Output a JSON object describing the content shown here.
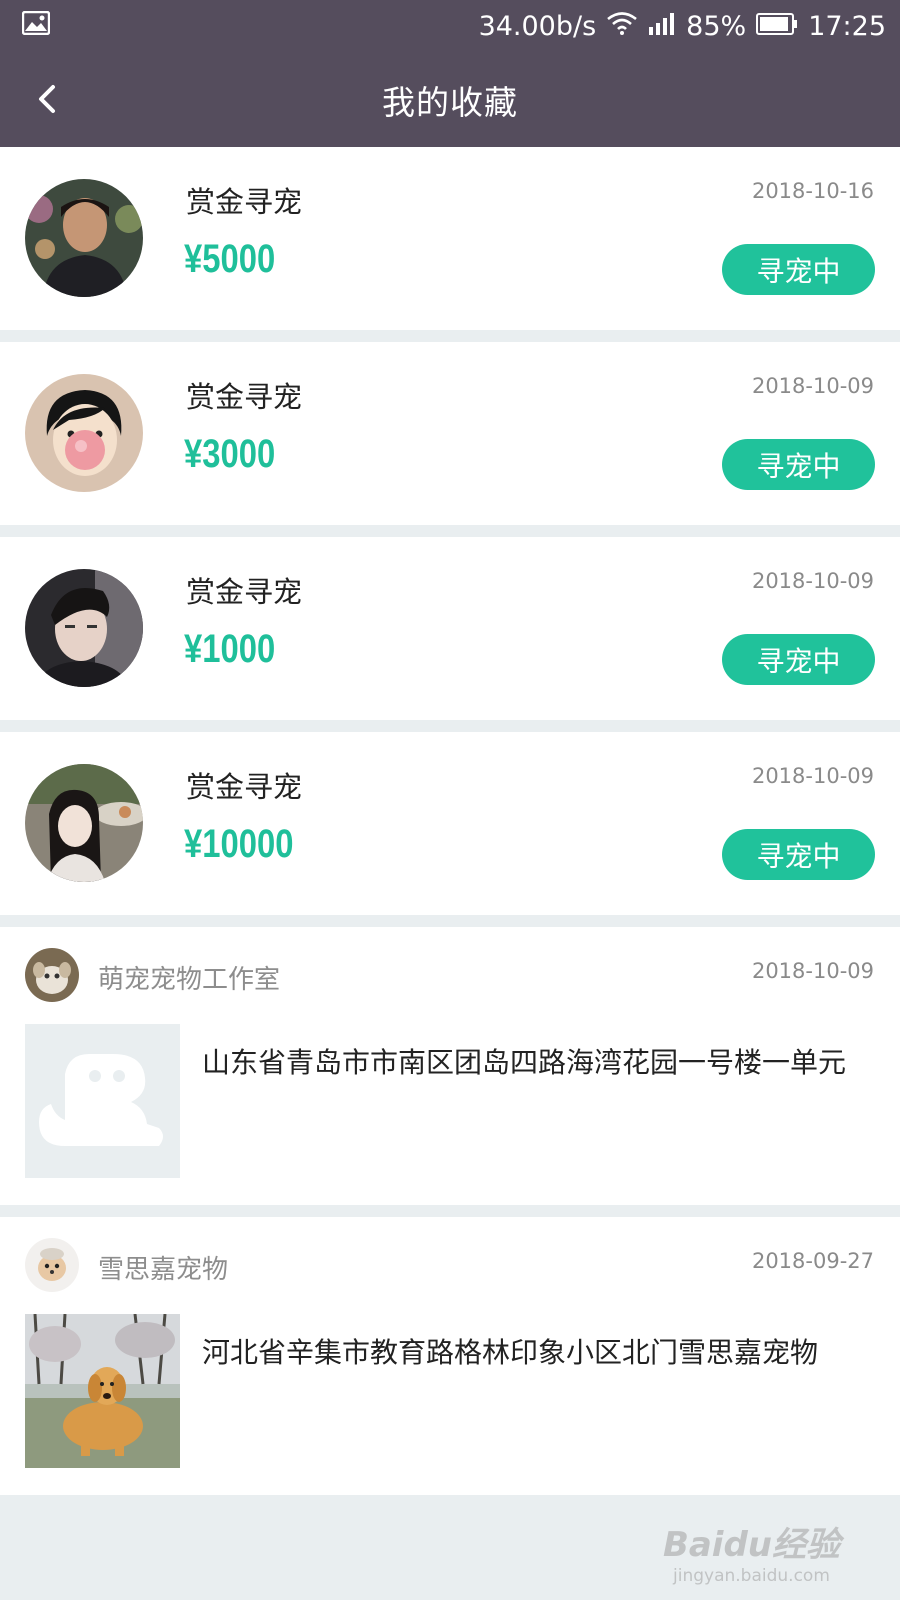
{
  "status_bar": {
    "speed": "34.00b/s",
    "battery": "85%",
    "time": "17:25",
    "icons": [
      "image-icon",
      "wifi-icon",
      "signal-icon",
      "battery-icon"
    ]
  },
  "header": {
    "title": "我的收藏",
    "back_icon": "back-arrow-icon"
  },
  "reward_posts": [
    {
      "title": "赏金寻宠",
      "amount": "¥5000",
      "date": "2018-10-16",
      "status": "寻宠中"
    },
    {
      "title": "赏金寻宠",
      "amount": "¥3000",
      "date": "2018-10-09",
      "status": "寻宠中"
    },
    {
      "title": "赏金寻宠",
      "amount": "¥1000",
      "date": "2018-10-09",
      "status": "寻宠中"
    },
    {
      "title": "赏金寻宠",
      "amount": "¥10000",
      "date": "2018-10-09",
      "status": "寻宠中"
    }
  ],
  "shops": [
    {
      "name": "萌宠宠物工作室",
      "date": "2018-10-09",
      "address": "山东省青岛市市南区团岛四路海湾花园一号楼一单元",
      "thumb": "placeholder"
    },
    {
      "name": "雪思嘉宠物",
      "date": "2018-09-27",
      "address": "河北省辛集市教育路格林印象小区北门雪思嘉宠物",
      "thumb": "dog-photo"
    }
  ],
  "watermark": {
    "main": "Baidu经验",
    "sub": "jingyan.baidu.com"
  },
  "colors": {
    "header_bg": "#554d5d",
    "accent": "#20c29b",
    "page_bg": "#e9eef0"
  }
}
